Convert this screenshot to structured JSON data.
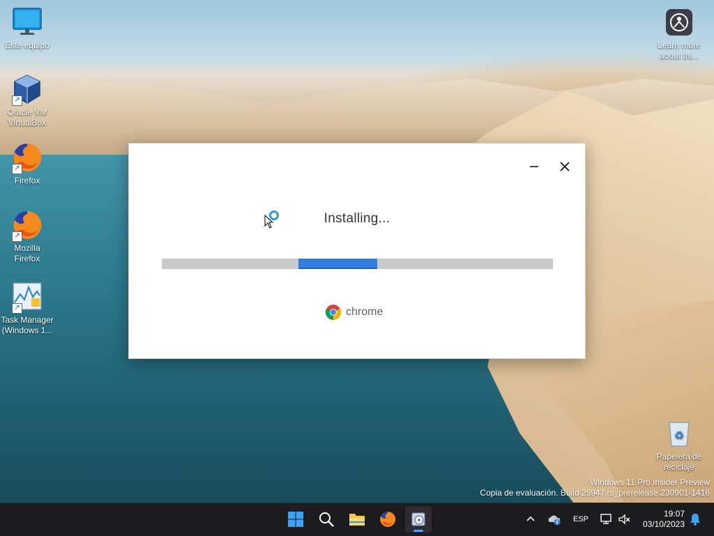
{
  "desktop": {
    "icons": [
      {
        "label": "Este equipo",
        "icon": "monitor-icon"
      },
      {
        "label": "Oracle VM VirtualBox",
        "icon": "virtualbox-icon"
      },
      {
        "label": "Firefox",
        "icon": "firefox-icon"
      },
      {
        "label": "Mozilla Firefox",
        "icon": "firefox-icon"
      },
      {
        "label": "Task Manager (Windows 1...",
        "icon": "task-manager-icon"
      }
    ],
    "right_icons": [
      {
        "label": "Learn more about thi...",
        "icon": "learn-more-icon"
      },
      {
        "label": "Papelera de reciclaje",
        "icon": "recycle-bin-icon"
      }
    ],
    "watermark": {
      "line1": "Windows 11 Pro Insider Preview",
      "line2": "Copia de evaluación. Build 25947.rs_prerelease.230901-1416"
    }
  },
  "installer": {
    "status": "Installing...",
    "progress_fraction": 0.2,
    "progress_start_fraction": 0.35,
    "brand_name": "chrome",
    "colors": {
      "progress": "#2f7ee2",
      "track": "#c9c9c9"
    }
  },
  "taskbar": {
    "apps": [
      "start-icon",
      "search-icon",
      "file-explorer-icon",
      "firefox-icon",
      "installer-icon"
    ],
    "tray": {
      "language": "ESP",
      "time": "19:07",
      "date": "03/10/2023"
    }
  }
}
